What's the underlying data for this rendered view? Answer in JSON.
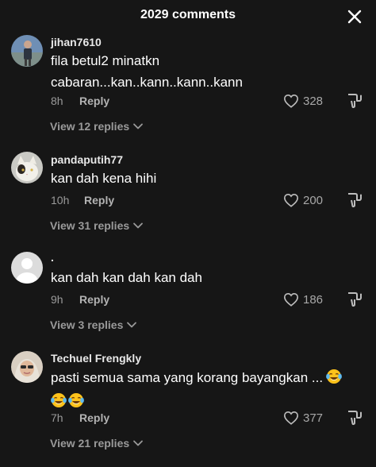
{
  "header": {
    "title": "2029 comments",
    "close_icon": "close-icon"
  },
  "comments": [
    {
      "username": "jihan7610",
      "lines": [
        "fila betul2 minatkn",
        "cabaran...kan..kann..kann..kann"
      ],
      "time": "8h",
      "reply_label": "Reply",
      "likes": "328",
      "view_replies": "View 12 replies"
    },
    {
      "username": "pandaputih77",
      "lines": [
        "kan dah kena hihi"
      ],
      "time": "10h",
      "reply_label": "Reply",
      "likes": "200",
      "view_replies": "View 31 replies"
    },
    {
      "username": ".",
      "lines": [
        "kan dah kan dah kan dah"
      ],
      "time": "9h",
      "reply_label": "Reply",
      "likes": "186",
      "view_replies": "View 3 replies"
    },
    {
      "username": "Techuel Frengkly",
      "lines": [
        "pasti semua sama yang korang bayangkan ..."
      ],
      "emojis": [
        "tears-of-joy",
        "tears-of-joy",
        "tears-of-joy"
      ],
      "time": "7h",
      "reply_label": "Reply",
      "likes": "377",
      "view_replies": "View 21 replies"
    }
  ],
  "colors": {
    "background": "#161616",
    "text": "#ffffff",
    "muted": "#9a9a9a"
  }
}
